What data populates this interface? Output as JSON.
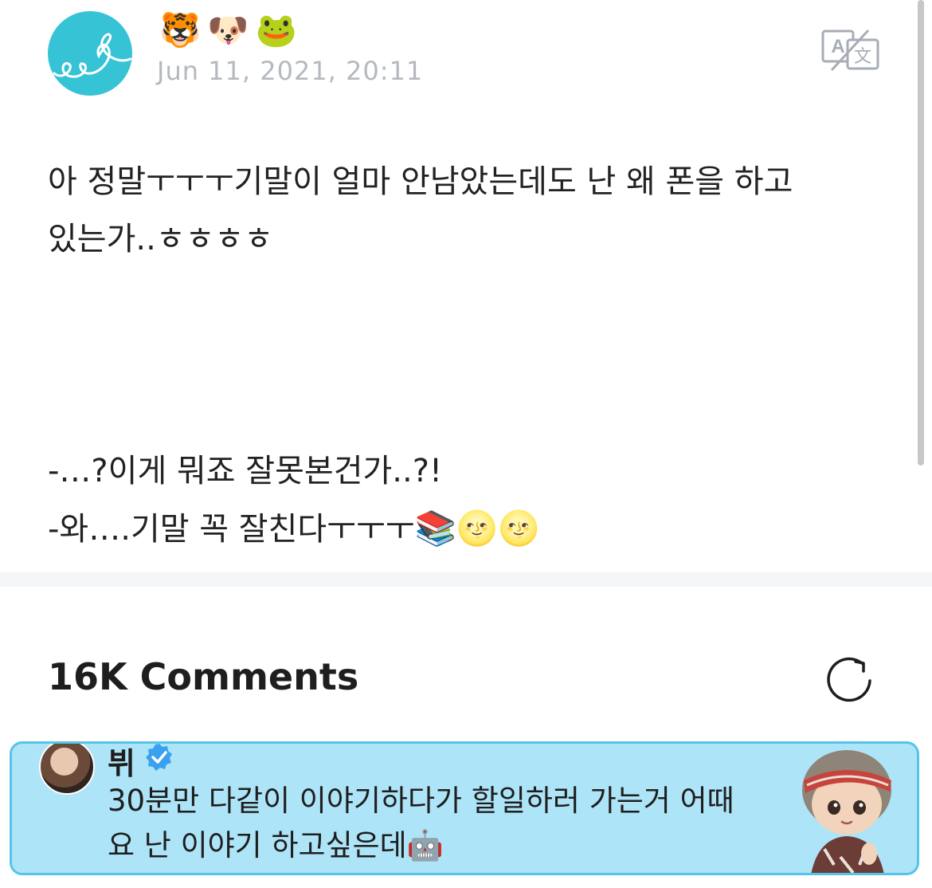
{
  "post": {
    "author_emojis": [
      "🐯",
      "🐶",
      "🐸"
    ],
    "timestamp": "Jun 11, 2021, 20:11",
    "lines": [
      "아 정말ㅜㅜㅜ기말이 얼마 안남았는데도 난 왜 폰을 하고",
      "있는가..ㅎㅎㅎㅎ",
      "-…?이게 뭐죠 잘못본건가..?!",
      "-와….기말 꼭 잘친다ㅜㅜㅜ"
    ],
    "line4_emojis": "📚🌝🌝",
    "icons": {
      "avatar": "heart-doodle-avatar",
      "translate": "translate-icon"
    }
  },
  "comments": {
    "title": "16K Comments",
    "refresh_icon": "refresh-icon"
  },
  "artist_comment": {
    "name": "뷔",
    "verified_icon": "verified-badge-icon",
    "text_line1": "30분만 다같이 이야기하다가 할일하러 가는거 어때",
    "text_line2": "요 난 이야기 하고싶은데",
    "text_emoji": "🤖",
    "card_color": "#aee4f7",
    "border_color": "#55c4eb"
  },
  "colors": {
    "timestamp": "#b4b9c0",
    "avatar_bg": "#36c3d6",
    "verified": "#3aa0f0"
  }
}
